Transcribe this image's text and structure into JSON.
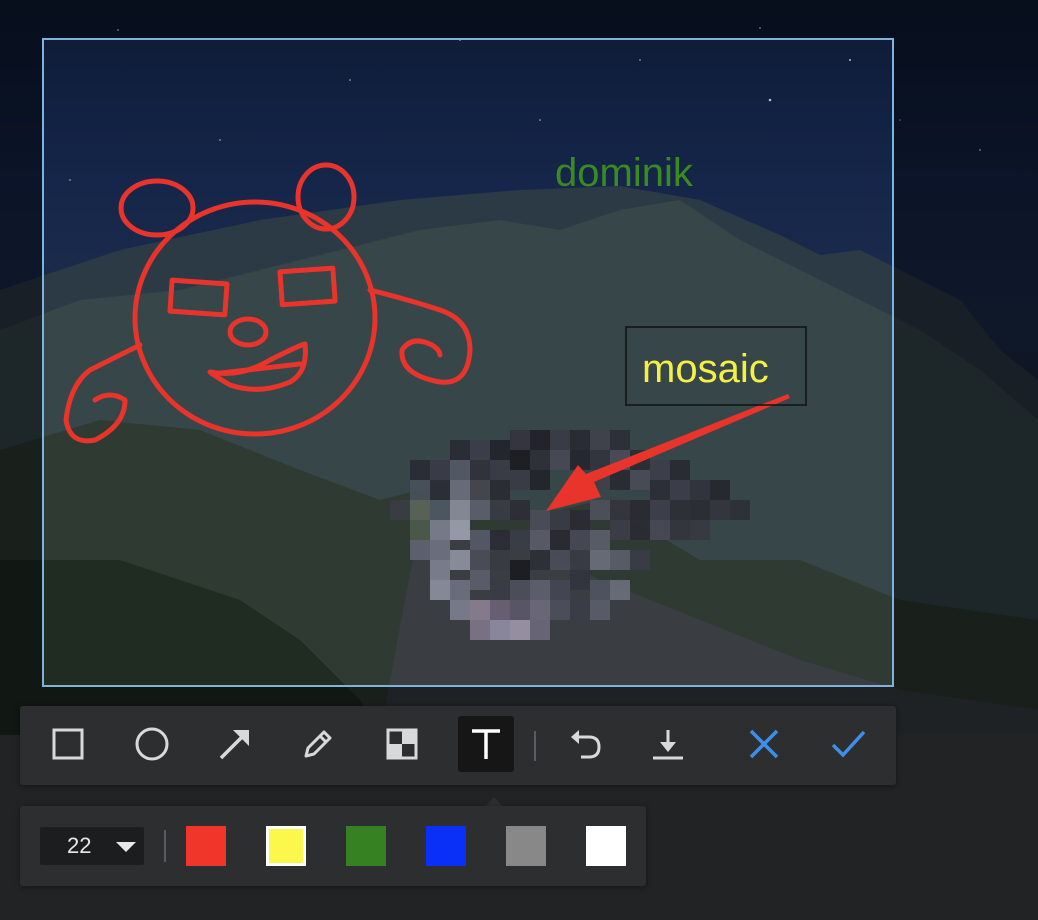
{
  "canvas": {
    "annotation_texts": {
      "top": "dominik",
      "boxed": "mosaic"
    },
    "colors": {
      "drawing": "#e8342a",
      "text_top": "#3a8a22",
      "text_boxed": "#f5f046",
      "selection_border": "#7db3dc"
    }
  },
  "toolbar": {
    "tools": [
      {
        "name": "rectangle-tool",
        "icon": "square-icon",
        "active": false
      },
      {
        "name": "ellipse-tool",
        "icon": "circle-icon",
        "active": false
      },
      {
        "name": "arrow-tool",
        "icon": "arrow-icon",
        "active": false
      },
      {
        "name": "pen-tool",
        "icon": "pencil-icon",
        "active": false
      },
      {
        "name": "mosaic-tool",
        "icon": "mosaic-icon",
        "active": false
      },
      {
        "name": "text-tool",
        "icon": "text-t-icon",
        "active": true
      },
      {
        "name": "undo-button",
        "icon": "undo-icon"
      },
      {
        "name": "download-button",
        "icon": "download-icon"
      },
      {
        "name": "cancel-button",
        "icon": "close-icon",
        "color": "#3d8fe8"
      },
      {
        "name": "confirm-button",
        "icon": "checkmark-icon",
        "color": "#3d8fe8"
      }
    ]
  },
  "options": {
    "font_size": "22",
    "swatches": [
      {
        "name": "red",
        "color": "#f0352b",
        "selected": false
      },
      {
        "name": "yellow",
        "color": "#fbf74b",
        "selected": true
      },
      {
        "name": "green",
        "color": "#368122",
        "selected": false
      },
      {
        "name": "blue",
        "color": "#0a2ff7",
        "selected": false
      },
      {
        "name": "gray",
        "color": "#888888",
        "selected": false
      },
      {
        "name": "white",
        "color": "#ffffff",
        "selected": false
      }
    ]
  }
}
